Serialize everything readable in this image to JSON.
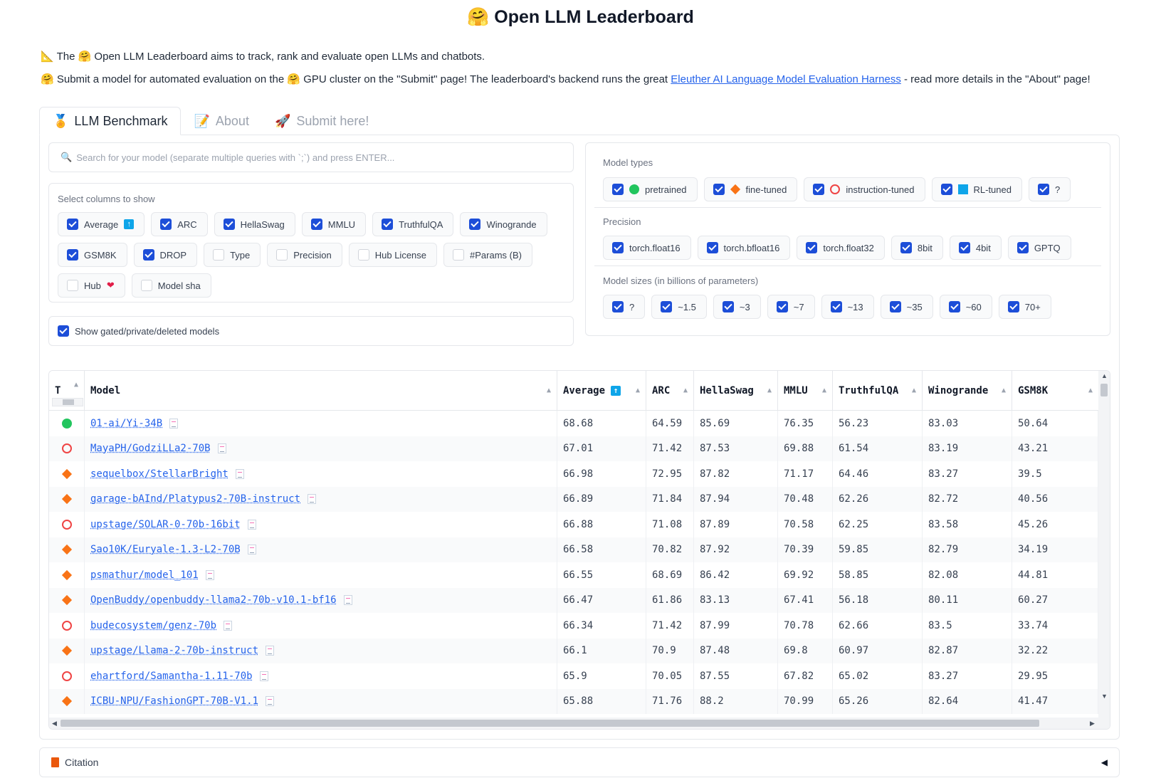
{
  "title": "🤗 Open LLM Leaderboard",
  "intro": {
    "line1": "📐 The 🤗 Open LLM Leaderboard aims to track, rank and evaluate open LLMs and chatbots.",
    "line2_before": "🤗 Submit a model for automated evaluation on the 🤗 GPU cluster on the \"Submit\" page! The leaderboard's backend runs the great ",
    "line2_link": "Eleuther AI Language Model Evaluation Harness",
    "line2_after": " - read more details in the \"About\" page!"
  },
  "tabs": [
    {
      "icon": "🏅",
      "label": "LLM Benchmark"
    },
    {
      "icon": "📝",
      "label": "About"
    },
    {
      "icon": "🚀",
      "label": "Submit here!"
    }
  ],
  "search": {
    "placeholder": "Search for your model (separate multiple queries with `;`) and press ENTER..."
  },
  "columns_panel": {
    "label": "Select columns to show",
    "options": [
      {
        "label": "Average",
        "checked": true,
        "badge": "up"
      },
      {
        "label": "ARC",
        "checked": true
      },
      {
        "label": "HellaSwag",
        "checked": true
      },
      {
        "label": "MMLU",
        "checked": true
      },
      {
        "label": "TruthfulQA",
        "checked": true
      },
      {
        "label": "Winogrande",
        "checked": true
      },
      {
        "label": "GSM8K",
        "checked": true
      },
      {
        "label": "DROP",
        "checked": true
      },
      {
        "label": "Type",
        "checked": false
      },
      {
        "label": "Precision",
        "checked": false
      },
      {
        "label": "Hub License",
        "checked": false
      },
      {
        "label": "#Params (B)",
        "checked": false
      },
      {
        "label": "Hub",
        "checked": false,
        "badge": "heart"
      },
      {
        "label": "Model sha",
        "checked": false
      }
    ]
  },
  "gated": {
    "label": "Show gated/private/deleted models",
    "checked": true
  },
  "model_types": {
    "label": "Model types",
    "options": [
      {
        "label": "pretrained",
        "icon": "green-dot"
      },
      {
        "label": "fine-tuned",
        "icon": "orange-diamond"
      },
      {
        "label": "instruction-tuned",
        "icon": "red-ring"
      },
      {
        "label": "RL-tuned",
        "icon": "blue-square"
      },
      {
        "label": "?",
        "icon": ""
      }
    ]
  },
  "precision": {
    "label": "Precision",
    "options": [
      "torch.float16",
      "torch.bfloat16",
      "torch.float32",
      "8bit",
      "4bit",
      "GPTQ"
    ]
  },
  "model_sizes": {
    "label": "Model sizes (in billions of parameters)",
    "options": [
      "?",
      "~1.5",
      "~3",
      "~7",
      "~13",
      "~35",
      "~60",
      "70+"
    ]
  },
  "table": {
    "headers": [
      "T",
      "Model",
      "Average",
      "ARC",
      "HellaSwag",
      "MMLU",
      "TruthfulQA",
      "Winogrande",
      "GSM8K"
    ],
    "rows": [
      {
        "type": "pretrained",
        "model": "01-ai/Yi-34B",
        "average": "68.68",
        "arc": "64.59",
        "hellaswag": "85.69",
        "mmlu": "76.35",
        "truthfulqa": "56.23",
        "winogrande": "83.03",
        "gsm8k": "50.64"
      },
      {
        "type": "instruction",
        "model": "MayaPH/GodziLLa2-70B",
        "average": "67.01",
        "arc": "71.42",
        "hellaswag": "87.53",
        "mmlu": "69.88",
        "truthfulqa": "61.54",
        "winogrande": "83.19",
        "gsm8k": "43.21"
      },
      {
        "type": "finetuned",
        "model": "sequelbox/StellarBright",
        "average": "66.98",
        "arc": "72.95",
        "hellaswag": "87.82",
        "mmlu": "71.17",
        "truthfulqa": "64.46",
        "winogrande": "83.27",
        "gsm8k": "39.5"
      },
      {
        "type": "finetuned",
        "model": "garage-bAInd/Platypus2-70B-instruct",
        "average": "66.89",
        "arc": "71.84",
        "hellaswag": "87.94",
        "mmlu": "70.48",
        "truthfulqa": "62.26",
        "winogrande": "82.72",
        "gsm8k": "40.56"
      },
      {
        "type": "instruction",
        "model": "upstage/SOLAR-0-70b-16bit",
        "average": "66.88",
        "arc": "71.08",
        "hellaswag": "87.89",
        "mmlu": "70.58",
        "truthfulqa": "62.25",
        "winogrande": "83.58",
        "gsm8k": "45.26"
      },
      {
        "type": "finetuned",
        "model": "Sao10K/Euryale-1.3-L2-70B",
        "average": "66.58",
        "arc": "70.82",
        "hellaswag": "87.92",
        "mmlu": "70.39",
        "truthfulqa": "59.85",
        "winogrande": "82.79",
        "gsm8k": "34.19"
      },
      {
        "type": "finetuned",
        "model": "psmathur/model_101",
        "average": "66.55",
        "arc": "68.69",
        "hellaswag": "86.42",
        "mmlu": "69.92",
        "truthfulqa": "58.85",
        "winogrande": "82.08",
        "gsm8k": "44.81"
      },
      {
        "type": "finetuned",
        "model": "OpenBuddy/openbuddy-llama2-70b-v10.1-bf16",
        "average": "66.47",
        "arc": "61.86",
        "hellaswag": "83.13",
        "mmlu": "67.41",
        "truthfulqa": "56.18",
        "winogrande": "80.11",
        "gsm8k": "60.27"
      },
      {
        "type": "instruction",
        "model": "budecosystem/genz-70b",
        "average": "66.34",
        "arc": "71.42",
        "hellaswag": "87.99",
        "mmlu": "70.78",
        "truthfulqa": "62.66",
        "winogrande": "83.5",
        "gsm8k": "33.74"
      },
      {
        "type": "finetuned",
        "model": "upstage/Llama-2-70b-instruct",
        "average": "66.1",
        "arc": "70.9",
        "hellaswag": "87.48",
        "mmlu": "69.8",
        "truthfulqa": "60.97",
        "winogrande": "82.87",
        "gsm8k": "32.22"
      },
      {
        "type": "instruction",
        "model": "ehartford/Samantha-1.11-70b",
        "average": "65.9",
        "arc": "70.05",
        "hellaswag": "87.55",
        "mmlu": "67.82",
        "truthfulqa": "65.02",
        "winogrande": "83.27",
        "gsm8k": "29.95"
      },
      {
        "type": "finetuned",
        "model": "ICBU-NPU/FashionGPT-70B-V1.1",
        "average": "65.88",
        "arc": "71.76",
        "hellaswag": "88.2",
        "mmlu": "70.99",
        "truthfulqa": "65.26",
        "winogrande": "82.64",
        "gsm8k": "41.47"
      }
    ]
  },
  "citation": {
    "label": "Citation"
  },
  "colors": {
    "accent": "#1d4ed8",
    "link": "#2563eb",
    "pretrained": "#22c55e",
    "finetuned": "#f97316",
    "instruction": "#ef4444",
    "rl": "#0ea5e9"
  }
}
